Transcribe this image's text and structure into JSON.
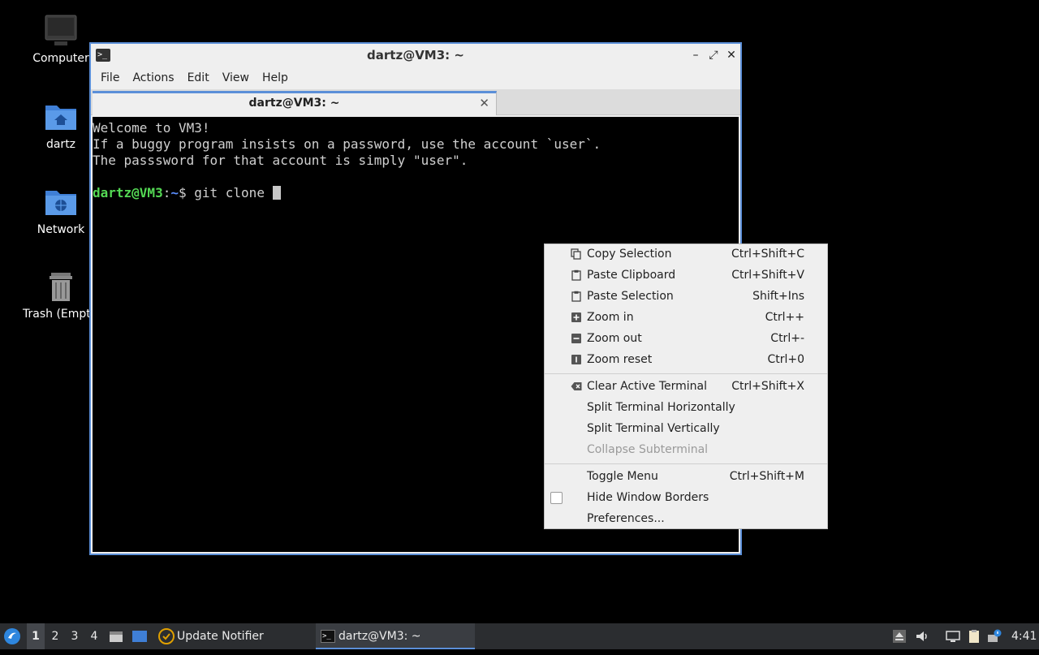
{
  "desktop": {
    "icons": [
      {
        "label": "Computer"
      },
      {
        "label": "dartz"
      },
      {
        "label": "Network"
      },
      {
        "label": "Trash (Empt"
      }
    ]
  },
  "window": {
    "title": "dartz@VM3: ~",
    "menu": [
      "File",
      "Actions",
      "Edit",
      "View",
      "Help"
    ],
    "tab_label": "dartz@VM3: ~",
    "terminal": {
      "lines": [
        "Welcome to VM3!",
        "If a buggy program insists on a password, use the account `user`.",
        "The passsword for that account is simply \"user\".",
        ""
      ],
      "prompt_user": "dartz@VM3",
      "prompt_sep": ":",
      "prompt_path": "~",
      "prompt_dollar": "$ ",
      "command": "git clone "
    }
  },
  "context_menu": {
    "items": [
      {
        "label": "Copy Selection",
        "shortcut": "Ctrl+Shift+C",
        "icon": "copy-icon"
      },
      {
        "label": "Paste Clipboard",
        "shortcut": "Ctrl+Shift+V",
        "icon": "paste-icon"
      },
      {
        "label": "Paste Selection",
        "shortcut": "Shift+Ins",
        "icon": "paste-icon"
      },
      {
        "label": "Zoom in",
        "shortcut": "Ctrl++",
        "icon": "zoom-in-icon"
      },
      {
        "label": "Zoom out",
        "shortcut": "Ctrl+-",
        "icon": "zoom-out-icon"
      },
      {
        "label": "Zoom reset",
        "shortcut": "Ctrl+0",
        "icon": "zoom-reset-icon"
      },
      {
        "label": "Clear Active Terminal",
        "shortcut": "Ctrl+Shift+X",
        "icon": "clear-icon"
      },
      {
        "label": "Split Terminal Horizontally",
        "shortcut": ""
      },
      {
        "label": "Split Terminal Vertically",
        "shortcut": ""
      },
      {
        "label": "Collapse Subterminal",
        "shortcut": "",
        "disabled": true
      },
      {
        "label": "Toggle Menu",
        "shortcut": "Ctrl+Shift+M"
      },
      {
        "label": "Hide Window Borders",
        "shortcut": "",
        "checkbox": false
      },
      {
        "label": "Preferences...",
        "shortcut": ""
      }
    ]
  },
  "taskbar": {
    "workspaces": [
      "1",
      "2",
      "3",
      "4"
    ],
    "active_workspace": "1",
    "tasks": [
      {
        "label": "Update Notifier"
      },
      {
        "label": "dartz@VM3: ~"
      }
    ],
    "clock": "4:41"
  },
  "colors": {
    "accent": "#5b8fd8",
    "prompt_user": "#54d954",
    "prompt_path": "#5b8fff",
    "taskbar_bg": "#2b2d30"
  }
}
